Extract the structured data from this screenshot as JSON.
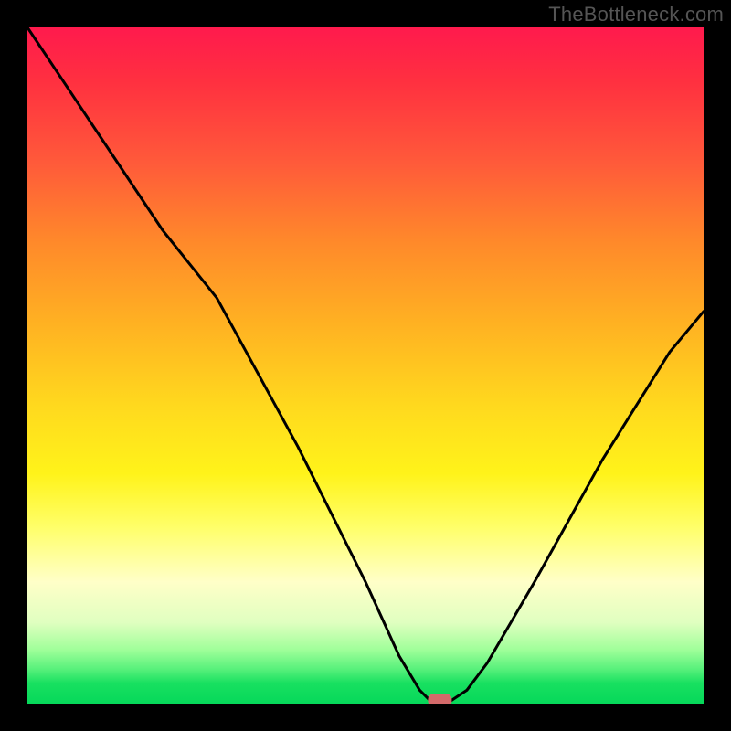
{
  "attribution": "TheBottleneck.com",
  "chart_data": {
    "type": "line",
    "title": "",
    "xlabel": "",
    "ylabel": "",
    "xlim": [
      0,
      100
    ],
    "ylim": [
      0,
      100
    ],
    "series": [
      {
        "name": "curve",
        "x": [
          0,
          8,
          20,
          28,
          40,
          50,
          55,
          58,
          60,
          62,
          65,
          68,
          75,
          85,
          95,
          100
        ],
        "values": [
          100,
          88,
          70,
          60,
          38,
          18,
          7,
          2,
          0,
          0,
          2,
          6,
          18,
          36,
          52,
          58
        ]
      }
    ],
    "marker": {
      "x": 61,
      "y": 0.5,
      "color": "#d46a6a",
      "shape": "rounded-rect"
    },
    "background_gradient_stops": [
      {
        "pos": 0,
        "color": "#ff1a4d"
      },
      {
        "pos": 8,
        "color": "#ff3040"
      },
      {
        "pos": 20,
        "color": "#ff5a3a"
      },
      {
        "pos": 32,
        "color": "#ff8a2a"
      },
      {
        "pos": 44,
        "color": "#ffb222"
      },
      {
        "pos": 56,
        "color": "#ffd91e"
      },
      {
        "pos": 66,
        "color": "#fff31a"
      },
      {
        "pos": 74,
        "color": "#ffff6a"
      },
      {
        "pos": 82,
        "color": "#ffffc8"
      },
      {
        "pos": 88,
        "color": "#e0ffc0"
      },
      {
        "pos": 92,
        "color": "#a0ff9a"
      },
      {
        "pos": 95,
        "color": "#55f07a"
      },
      {
        "pos": 97,
        "color": "#18e060"
      },
      {
        "pos": 100,
        "color": "#06d85a"
      }
    ]
  }
}
